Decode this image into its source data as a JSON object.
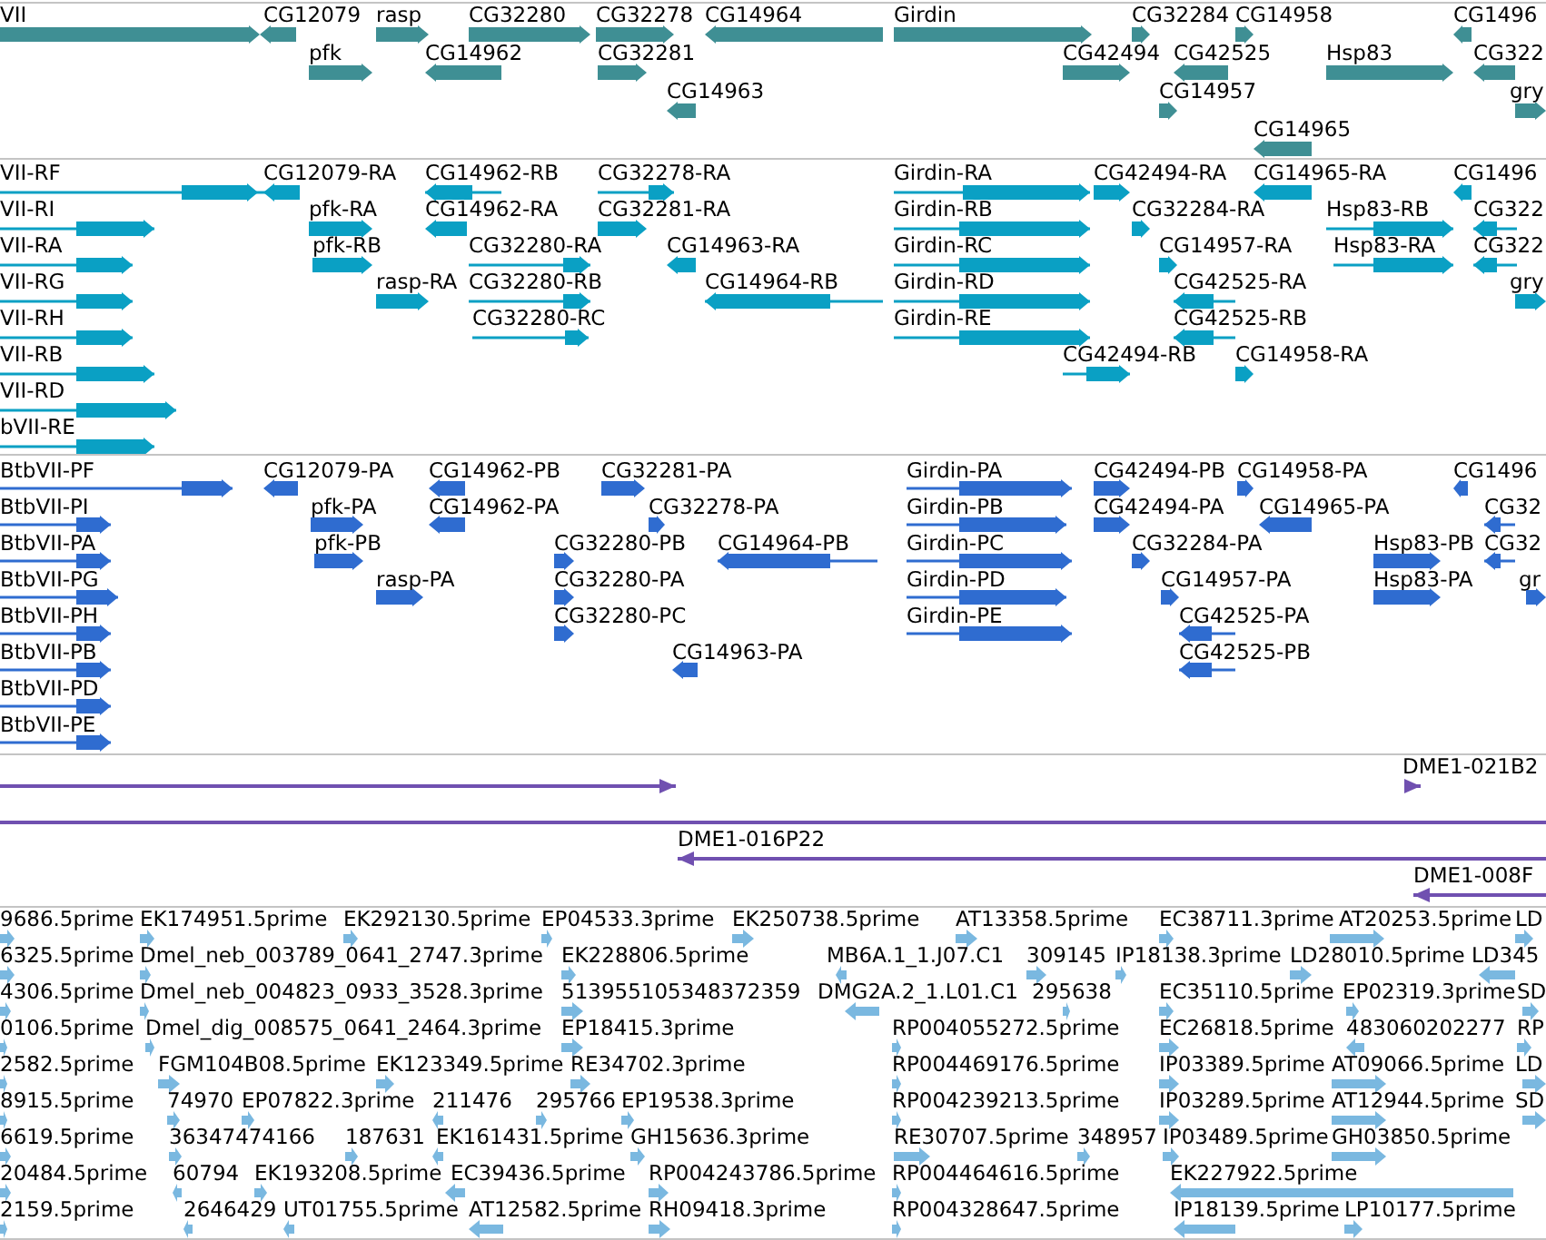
{
  "tracks": [
    {
      "kind": "gene",
      "features": [
        {
          "label": "VII",
          "reverse": false
        },
        {
          "label": "CG12079",
          "reverse": true
        },
        {
          "label": "rasp",
          "reverse": false
        },
        {
          "label": "CG32280",
          "reverse": false
        },
        {
          "label": "CG32278",
          "reverse": false
        },
        {
          "label": "CG14964",
          "reverse": true
        },
        {
          "label": "Girdin",
          "reverse": false
        },
        {
          "label": "CG32284",
          "reverse": false
        },
        {
          "label": "CG14958",
          "reverse": false
        },
        {
          "label": "CG1496",
          "reverse": true
        },
        {
          "label": "pfk",
          "reverse": false
        },
        {
          "label": "CG14962",
          "reverse": true
        },
        {
          "label": "CG32281",
          "reverse": false
        },
        {
          "label": "CG42494",
          "reverse": false
        },
        {
          "label": "CG42525",
          "reverse": true
        },
        {
          "label": "Hsp83",
          "reverse": false
        },
        {
          "label": "CG322",
          "reverse": true
        },
        {
          "label": "CG14963",
          "reverse": true
        },
        {
          "label": "CG14957",
          "reverse": false
        },
        {
          "label": "gry",
          "reverse": false
        },
        {
          "label": "CG14965",
          "reverse": true
        }
      ]
    },
    {
      "kind": "transcript",
      "features": [
        {
          "label": "VII-RF",
          "reverse": false
        },
        {
          "label": "CG12079-RA",
          "reverse": true
        },
        {
          "label": "CG14962-RB",
          "reverse": true
        },
        {
          "label": "CG32278-RA",
          "reverse": false
        },
        {
          "label": "Girdin-RA",
          "reverse": false
        },
        {
          "label": "CG42494-RA",
          "reverse": false
        },
        {
          "label": "CG14965-RA",
          "reverse": true
        },
        {
          "label": "CG1496",
          "reverse": true
        },
        {
          "label": "VII-RI",
          "reverse": false
        },
        {
          "label": "pfk-RA",
          "reverse": false
        },
        {
          "label": "CG14962-RA",
          "reverse": true
        },
        {
          "label": "CG32281-RA",
          "reverse": false
        },
        {
          "label": "Girdin-RB",
          "reverse": false
        },
        {
          "label": "CG32284-RA",
          "reverse": false
        },
        {
          "label": "Hsp83-RB",
          "reverse": false
        },
        {
          "label": "CG322",
          "reverse": true
        },
        {
          "label": "VII-RA",
          "reverse": false
        },
        {
          "label": "pfk-RB",
          "reverse": false
        },
        {
          "label": "CG32280-RA",
          "reverse": false
        },
        {
          "label": "CG14963-RA",
          "reverse": true
        },
        {
          "label": "Girdin-RC",
          "reverse": false
        },
        {
          "label": "CG14957-RA",
          "reverse": false
        },
        {
          "label": "Hsp83-RA",
          "reverse": false
        },
        {
          "label": "CG322",
          "reverse": true
        },
        {
          "label": "VII-RG",
          "reverse": false
        },
        {
          "label": "rasp-RA",
          "reverse": false
        },
        {
          "label": "CG32280-RB",
          "reverse": false
        },
        {
          "label": "CG14964-RB",
          "reverse": true
        },
        {
          "label": "Girdin-RD",
          "reverse": false
        },
        {
          "label": "CG42525-RA",
          "reverse": true
        },
        {
          "label": "gry",
          "reverse": false
        },
        {
          "label": "VII-RH",
          "reverse": false
        },
        {
          "label": "CG32280-RC",
          "reverse": false
        },
        {
          "label": "Girdin-RE",
          "reverse": false
        },
        {
          "label": "CG42525-RB",
          "reverse": true
        },
        {
          "label": "VII-RB",
          "reverse": false
        },
        {
          "label": "CG42494-RB",
          "reverse": false
        },
        {
          "label": "CG14958-RA",
          "reverse": false
        },
        {
          "label": "VII-RD",
          "reverse": false
        },
        {
          "label": "bVII-RE",
          "reverse": false
        }
      ]
    },
    {
      "kind": "protein",
      "features": [
        {
          "label": "BtbVII-PF",
          "reverse": false
        },
        {
          "label": "CG12079-PA",
          "reverse": true
        },
        {
          "label": "CG14962-PB",
          "reverse": true
        },
        {
          "label": "CG32281-PA",
          "reverse": false
        },
        {
          "label": "Girdin-PA",
          "reverse": false
        },
        {
          "label": "CG42494-PB",
          "reverse": false
        },
        {
          "label": "CG14958-PA",
          "reverse": false
        },
        {
          "label": "CG1496",
          "reverse": true
        },
        {
          "label": "BtbVII-PI",
          "reverse": false
        },
        {
          "label": "pfk-PA",
          "reverse": false
        },
        {
          "label": "CG14962-PA",
          "reverse": true
        },
        {
          "label": "CG32278-PA",
          "reverse": false
        },
        {
          "label": "Girdin-PB",
          "reverse": false
        },
        {
          "label": "CG42494-PA",
          "reverse": false
        },
        {
          "label": "CG14965-PA",
          "reverse": true
        },
        {
          "label": "CG32",
          "reverse": true
        },
        {
          "label": "BtbVII-PA",
          "reverse": false
        },
        {
          "label": "pfk-PB",
          "reverse": false
        },
        {
          "label": "CG32280-PB",
          "reverse": false
        },
        {
          "label": "CG14964-PB",
          "reverse": true
        },
        {
          "label": "Girdin-PC",
          "reverse": false
        },
        {
          "label": "CG32284-PA",
          "reverse": false
        },
        {
          "label": "Hsp83-PB",
          "reverse": false
        },
        {
          "label": "CG32",
          "reverse": true
        },
        {
          "label": "BtbVII-PG",
          "reverse": false
        },
        {
          "label": "rasp-PA",
          "reverse": false
        },
        {
          "label": "CG32280-PA",
          "reverse": false
        },
        {
          "label": "Girdin-PD",
          "reverse": false
        },
        {
          "label": "CG14957-PA",
          "reverse": false
        },
        {
          "label": "Hsp83-PA",
          "reverse": false
        },
        {
          "label": "gr",
          "reverse": false
        },
        {
          "label": "BtbVII-PH",
          "reverse": false
        },
        {
          "label": "CG32280-PC",
          "reverse": false
        },
        {
          "label": "Girdin-PE",
          "reverse": false
        },
        {
          "label": "CG42525-PA",
          "reverse": true
        },
        {
          "label": "BtbVII-PB",
          "reverse": false
        },
        {
          "label": "CG14963-PA",
          "reverse": true
        },
        {
          "label": "CG42525-PB",
          "reverse": true
        },
        {
          "label": "BtbVII-PD",
          "reverse": false
        },
        {
          "label": "BtbVII-PE",
          "reverse": false
        }
      ]
    },
    {
      "kind": "clone",
      "features": [
        {
          "kind": "arrow",
          "reverse": false
        },
        {
          "kind": "arrow",
          "label": "DME1-021B2",
          "reverse": false
        },
        {
          "kind": "line"
        },
        {
          "kind": "arrow",
          "label": "DME1-016P22",
          "reverse": true
        },
        {
          "kind": "arrow",
          "label": "DME1-008F",
          "reverse": true
        }
      ]
    },
    {
      "kind": "est",
      "features": [
        {
          "label": "9686.5prime",
          "reverse": false
        },
        {
          "label": "EK174951.5prime",
          "reverse": false
        },
        {
          "label": "EK292130.5prime",
          "reverse": false
        },
        {
          "label": "EP04533.3prime",
          "reverse": false
        },
        {
          "label": "EK250738.5prime",
          "reverse": false
        },
        {
          "label": "AT13358.5prime",
          "reverse": false
        },
        {
          "label": "EC38711.3prime",
          "reverse": false
        },
        {
          "label": "AT20253.5prime",
          "reverse": false
        },
        {
          "label": "LD",
          "reverse": false
        },
        {
          "label": "6325.5prime",
          "reverse": false
        },
        {
          "label": "Dmel_neb_003789_0641_2747.3prime",
          "reverse": false
        },
        {
          "label": "EK228806.5prime",
          "reverse": false
        },
        {
          "label": "MB6A.1_1.J07.C1",
          "reverse": true
        },
        {
          "label": "309145",
          "reverse": false
        },
        {
          "label": "IP18138.3prime",
          "reverse": false
        },
        {
          "label": "LD28010.5prime",
          "reverse": false
        },
        {
          "label": "LD345",
          "reverse": true
        },
        {
          "label": "4306.5prime",
          "reverse": false
        },
        {
          "label": "Dmel_neb_004823_0933_3528.3prime",
          "reverse": false
        },
        {
          "label": "513955105348372359",
          "reverse": false
        },
        {
          "label": "DMG2A.2_1.L01.C1",
          "reverse": true
        },
        {
          "label": "295638",
          "reverse": false
        },
        {
          "label": "EC35110.5prime",
          "reverse": false
        },
        {
          "label": "EP02319.3prime",
          "reverse": false
        },
        {
          "label": "SD",
          "reverse": false
        },
        {
          "label": "0106.5prime",
          "reverse": false
        },
        {
          "label": "Dmel_dig_008575_0641_2464.3prime",
          "reverse": false
        },
        {
          "label": "EP18415.3prime",
          "reverse": false
        },
        {
          "label": "RP004055272.5prime",
          "reverse": false
        },
        {
          "label": "EC26818.5prime",
          "reverse": false
        },
        {
          "label": "483060202277",
          "reverse": true
        },
        {
          "label": "RP",
          "reverse": false
        },
        {
          "label": "2582.5prime",
          "reverse": false
        },
        {
          "label": "FGM104B08.5prime",
          "reverse": false
        },
        {
          "label": "EK123349.5prime",
          "reverse": false
        },
        {
          "label": "RE34702.3prime",
          "reverse": false
        },
        {
          "label": "RP004469176.5prime",
          "reverse": false
        },
        {
          "label": "IP03389.5prime",
          "reverse": false
        },
        {
          "label": "AT09066.5prime",
          "reverse": false
        },
        {
          "label": "LD",
          "reverse": false
        },
        {
          "label": "8915.5prime",
          "reverse": false
        },
        {
          "label": "74970",
          "reverse": false
        },
        {
          "label": "EP07822.3prime",
          "reverse": false
        },
        {
          "label": "211476",
          "reverse": true
        },
        {
          "label": "295766",
          "reverse": false
        },
        {
          "label": "EP19538.3prime",
          "reverse": false
        },
        {
          "label": "RP004239213.5prime",
          "reverse": false
        },
        {
          "label": "IP03289.5prime",
          "reverse": false
        },
        {
          "label": "AT12944.5prime",
          "reverse": false
        },
        {
          "label": "SD",
          "reverse": false
        },
        {
          "label": "6619.5prime",
          "reverse": false
        },
        {
          "label": "36347474166",
          "reverse": false
        },
        {
          "label": "187631",
          "reverse": false
        },
        {
          "label": "EK161431.5prime",
          "reverse": true
        },
        {
          "label": "GH15636.3prime",
          "reverse": false
        },
        {
          "label": "RE30707.5prime",
          "reverse": false
        },
        {
          "label": "348957",
          "reverse": false
        },
        {
          "label": "IP03489.5prime",
          "reverse": false
        },
        {
          "label": "GH03850.5prime",
          "reverse": false
        },
        {
          "label": "20484.5prime",
          "reverse": false
        },
        {
          "label": "60794",
          "reverse": true
        },
        {
          "label": "EK193208.5prime",
          "reverse": false
        },
        {
          "label": "EC39436.5prime",
          "reverse": true
        },
        {
          "label": "RP004243786.5prime",
          "reverse": false
        },
        {
          "label": "RP004464616.5prime",
          "reverse": false
        },
        {
          "label": "EK227922.5prime",
          "reverse": true
        },
        {
          "label": "2159.5prime",
          "reverse": false
        },
        {
          "label": "2646429",
          "reverse": true
        },
        {
          "label": "UT01755.5prime",
          "reverse": true
        },
        {
          "label": "AT12582.5prime",
          "reverse": true
        },
        {
          "label": "RH09418.3prime",
          "reverse": false
        },
        {
          "label": "RP004328647.5prime",
          "reverse": false
        },
        {
          "label": "IP18139.5prime",
          "reverse": true
        },
        {
          "label": "LP10177.5prime",
          "reverse": false
        }
      ]
    }
  ]
}
